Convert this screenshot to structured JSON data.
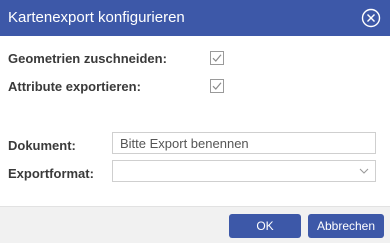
{
  "dialog": {
    "title": "Kartenexport konfigurieren",
    "close_icon": "close-circle-icon"
  },
  "options": {
    "clip_geometries_label": "Geometrien zuschneiden:",
    "clip_geometries_checked": true,
    "export_attributes_label": "Attribute exportieren:",
    "export_attributes_checked": true
  },
  "document": {
    "label": "Dokument:",
    "value": "",
    "placeholder": "Bitte Export benennen"
  },
  "export_format": {
    "label": "Exportformat:",
    "selected": "",
    "arrow_icon": "chevron-down-icon"
  },
  "footer": {
    "ok_label": "OK",
    "cancel_label": "Abbrechen"
  },
  "colors": {
    "accent": "#3d58a8",
    "title_text": "#ffffff",
    "footer_bg": "#f1f1f1"
  }
}
